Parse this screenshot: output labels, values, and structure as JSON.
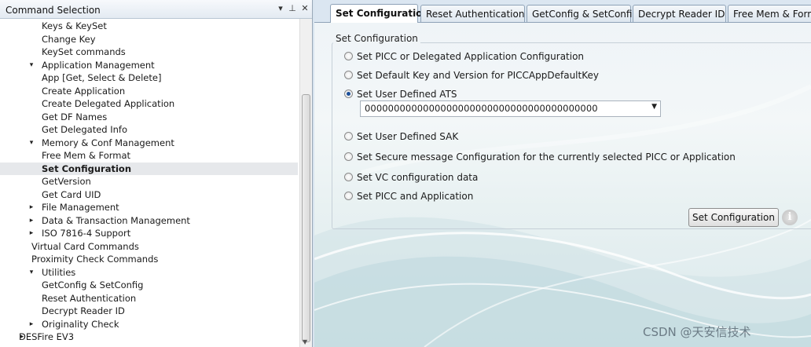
{
  "left_panel": {
    "title": "Command Selection",
    "buttons": {
      "dropdown": "▾",
      "pin": "⊥",
      "close": "✕"
    },
    "tree": [
      {
        "label": "Keys & KeySet",
        "depth": 2
      },
      {
        "label": "Change Key",
        "depth": 2
      },
      {
        "label": "KeySet commands",
        "depth": 2
      },
      {
        "label": "Application Management",
        "depth": 1,
        "arrow": "▾"
      },
      {
        "label": "App [Get, Select & Delete]",
        "depth": 2
      },
      {
        "label": "Create Application",
        "depth": 2
      },
      {
        "label": "Create Delegated Application",
        "depth": 2
      },
      {
        "label": "Get DF Names",
        "depth": 2
      },
      {
        "label": "Get Delegated Info",
        "depth": 2
      },
      {
        "label": "Memory & Conf Management",
        "depth": 1,
        "arrow": "▾"
      },
      {
        "label": "Free Mem & Format",
        "depth": 2
      },
      {
        "label": "Set Configuration",
        "depth": 2,
        "selected": true
      },
      {
        "label": "GetVersion",
        "depth": 2
      },
      {
        "label": "Get Card UID",
        "depth": 2
      },
      {
        "label": "File Management",
        "depth": 1,
        "arrow": "▸"
      },
      {
        "label": "Data & Transaction Management",
        "depth": 1,
        "arrow": "▸"
      },
      {
        "label": "ISO 7816-4 Support",
        "depth": 1,
        "arrow": "▸"
      },
      {
        "label": "Virtual Card Commands",
        "depth": 0
      },
      {
        "label": "Proximity Check Commands",
        "depth": 0
      },
      {
        "label": "Utilities",
        "depth": 1,
        "arrow": "▾"
      },
      {
        "label": "GetConfig & SetConfig",
        "depth": 2
      },
      {
        "label": "Reset Authentication",
        "depth": 2
      },
      {
        "label": "Decrypt Reader ID",
        "depth": 2
      },
      {
        "label": "Originality Check",
        "depth": 1,
        "arrow": "▸"
      },
      {
        "label": "DESFire EV3",
        "depth": -1,
        "arrow": "▸"
      }
    ]
  },
  "tabs": [
    {
      "label": "Set Configuration",
      "active": true
    },
    {
      "label": "Reset Authentication"
    },
    {
      "label": "GetConfig & SetConfig"
    },
    {
      "label": "Decrypt Reader ID"
    },
    {
      "label": "Free Mem & Format"
    }
  ],
  "group": {
    "legend": "Set Configuration",
    "options": [
      {
        "label": "Set PICC or Delegated Application Configuration",
        "checked": false
      },
      {
        "label": "Set Default Key and Version for PICCAppDefaultKey",
        "checked": false
      },
      {
        "label": "Set User Defined ATS",
        "checked": true
      },
      {
        "label": "Set User Defined SAK",
        "checked": false
      },
      {
        "label": "Set Secure message Configuration for the currently selected PICC or Application",
        "checked": false
      },
      {
        "label": "Set VC configuration data",
        "checked": false
      },
      {
        "label": "Set PICC and Application",
        "checked": false
      }
    ],
    "ats_value": "0000000000000000000000000000000000000000",
    "button_label": "Set Configuration",
    "info_icon": "i"
  },
  "watermark": "CSDN @天安信技术"
}
